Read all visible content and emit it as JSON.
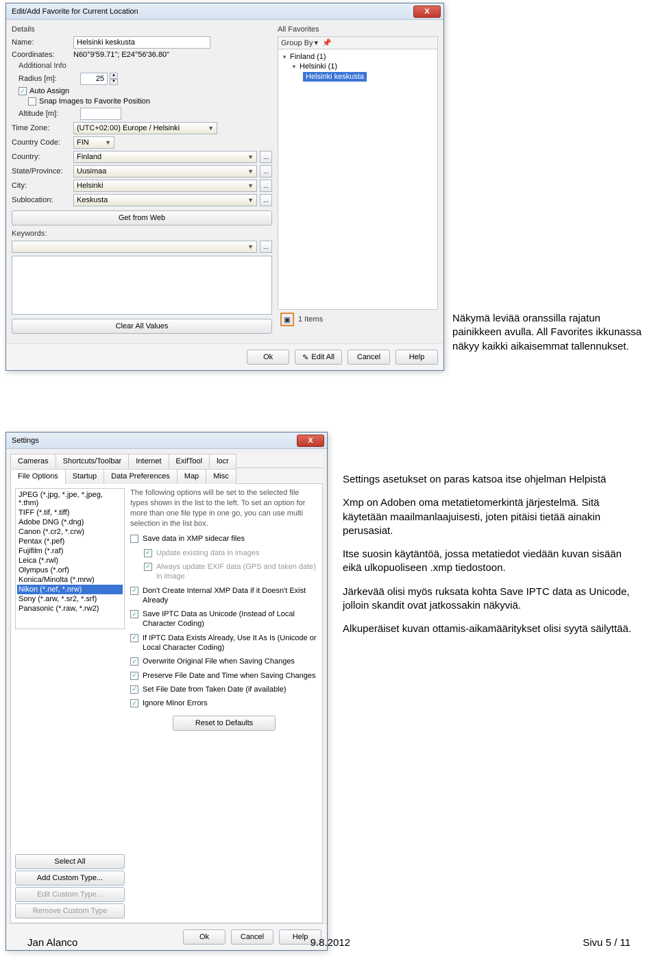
{
  "fav": {
    "title": "Edit/Add Favorite for Current Location",
    "details_label": "Details",
    "allfav_label": "All Favorites",
    "name_label": "Name:",
    "name_value": "Helsinki keskusta",
    "coords_label": "Coordinates:",
    "coords_value": "N60°9'59.71\"; E24°56'36.80\"",
    "addinfo_label": "Additional Info",
    "radius_label": "Radius [m]:",
    "radius_value": "25",
    "auto_assign": "Auto Assign",
    "snap": "Snap Images to Favorite Position",
    "altitude_label": "Altitude [m]:",
    "tz_label": "Time Zone:",
    "tz_value": "(UTC+02:00) Europe / Helsinki",
    "cc_label": "Country Code:",
    "cc_value": "FIN",
    "country_label": "Country:",
    "country_value": "Finland",
    "state_label": "State/Province:",
    "state_value": "Uusimaa",
    "city_label": "City:",
    "city_value": "Helsinki",
    "subloc_label": "Sublocation:",
    "subloc_value": "Keskusta",
    "get_from_web": "Get from Web",
    "keywords_label": "Keywords:",
    "clear_all": "Clear All Values",
    "group_by": "Group By",
    "tree_root": "Finland (1)",
    "tree_child": "Helsinki (1)",
    "tree_leaf": "Helsinki keskusta",
    "items_count": "1 Items",
    "ok": "Ok",
    "edit_all": "Edit All",
    "cancel": "Cancel",
    "help": "Help",
    "close_x": "X"
  },
  "settings": {
    "title": "Settings",
    "tabs_row1": [
      "Cameras",
      "Shortcuts/Toolbar",
      "Internet",
      "ExifTool",
      "locr"
    ],
    "tabs_row2": [
      "File Options",
      "Startup",
      "Data Preferences",
      "Map",
      "Misc"
    ],
    "active_tab": "File Options",
    "filetypes": [
      "JPEG (*.jpg, *.jpe, *.jpeg, *.thm)",
      "TIFF (*.tif, *.tiff)",
      "Adobe DNG (*.dng)",
      "Canon (*.cr2, *.crw)",
      "Pentax (*.pef)",
      "Fujifilm (*.raf)",
      "Leica (*.rwl)",
      "Olympus (*.orf)",
      "Konica/Minolta (*.mrw)",
      "Nikon (*.nef, *.nrw)",
      "Sony (*.arw, *.sr2, *.srf)",
      "Panasonic (*.raw, *.rw2)"
    ],
    "selected_filetype_idx": 9,
    "desc": "The following options will be set to the selected file types shown in the list to the left. To set an option for more than one file type in one go, you can use multi selection in the list box.",
    "opts": {
      "save_sidecar": "Save data in XMP sidecar files",
      "update_existing": "Update existing data in images",
      "always_update_exif": "Always update EXIF data (GPS and taken date) in image",
      "dont_create_internal": "Don't Create Internal XMP Data if it Doesn't Exist Already",
      "save_iptc_unicode": "Save IPTC Data as Unicode (Instead of Local Character Coding)",
      "if_iptc_exists": "If IPTC Data Exists Already, Use It As Is (Unicode or Local Character Coding)",
      "overwrite_original": "Overwrite Original File when Saving Changes",
      "preserve_date": "Preserve File Date and Time when Saving Changes",
      "set_file_date": "Set File Date from Taken Date (if available)",
      "ignore_minor": "Ignore Minor Errors"
    },
    "reset": "Reset to Defaults",
    "select_all": "Select All",
    "add_custom": "Add Custom Type...",
    "edit_custom": "Edit Custom Type...",
    "remove_custom": "Remove Custom Type",
    "ok": "Ok",
    "cancel": "Cancel",
    "help": "Help",
    "close_x": "X"
  },
  "annot1": {
    "p1": "Näkymä leviää oranssilla rajatun painikkeen avulla. All Favorites ikkunassa näkyy kaikki aikaisemmat tallennukset."
  },
  "annot2": {
    "p1": "Settings asetukset on paras katsoa itse ohjelman Helpistä",
    "p2": "Xmp on Adoben oma metatietomerkintä järjestelmä. Sitä käytetään maailmanlaajuisesti, joten pitäisi tietää ainakin perusasiat.",
    "p3": "Itse suosin käytäntöä, jossa metatiedot viedään kuvan sisään eikä ulkopuoliseen .xmp tiedostoon.",
    "p4": "Järkevää olisi myös ruksata kohta Save IPTC data as Unicode, jolloin skandit ovat jatkossakin näkyviä.",
    "p5": "Alkuperäiset kuvan ottamis-aikamääritykset olisi syytä säilyttää."
  },
  "footer": {
    "left": "Jan Alanco",
    "center": "9.8.2012",
    "right": "Sivu 5 / 11"
  }
}
